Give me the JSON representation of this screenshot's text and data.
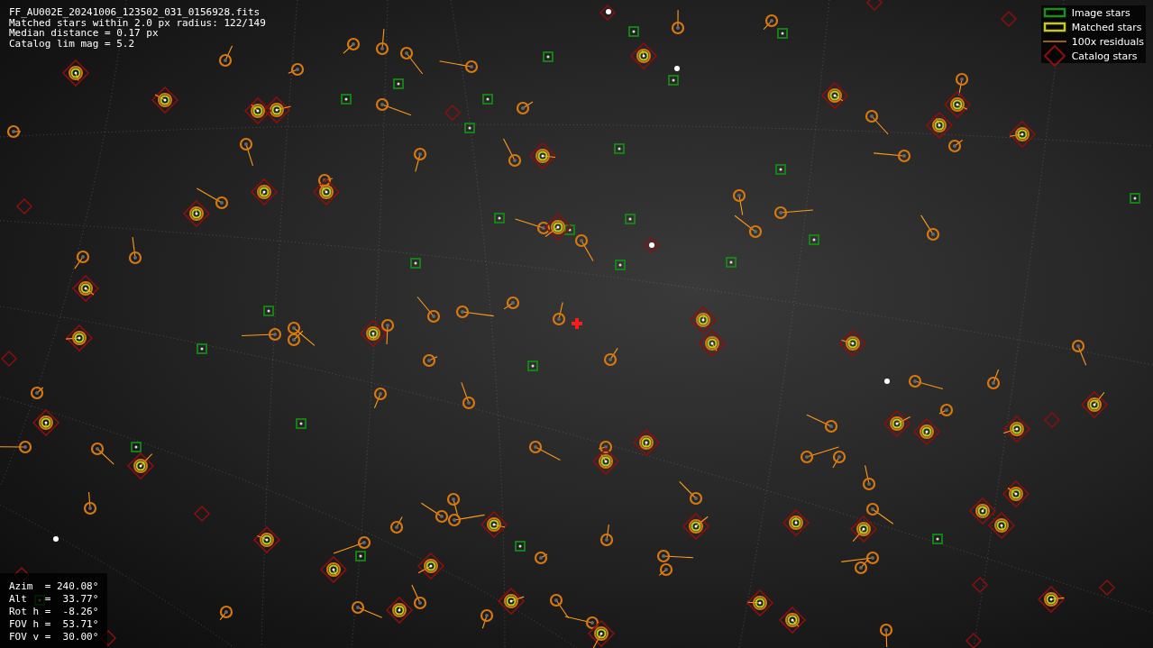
{
  "file_info": {
    "lines": [
      "FF_AU002E_20241006_123502_031_0156928.fits",
      "Matched stars within 2.0 px radius: 122/149",
      "Median distance = 0.17 px",
      "Catalog lim mag = 5.2"
    ]
  },
  "legend": [
    {
      "kind": "image",
      "label": "Image stars"
    },
    {
      "kind": "matched",
      "label": "Matched stars"
    },
    {
      "kind": "residual",
      "label": "100x residuals"
    },
    {
      "kind": "catalog",
      "label": "Catalog stars"
    }
  ],
  "pointing": {
    "lines": [
      "Azim  = 240.08°",
      "Alt   =  33.77°",
      "Rot h =  -8.26°",
      "FOV h =  53.71°",
      "FOV v =  30.00°"
    ]
  }
}
